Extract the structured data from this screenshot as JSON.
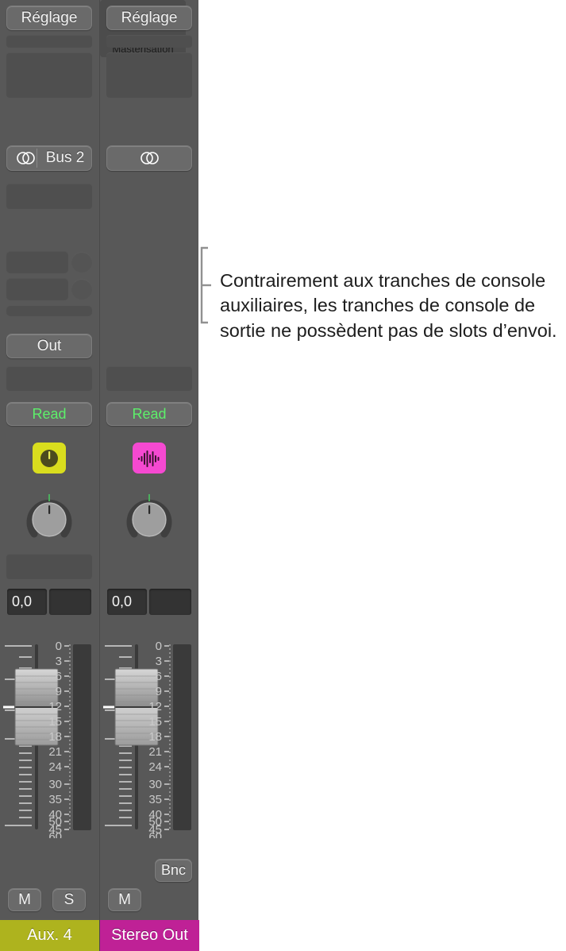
{
  "mixer": {
    "background_color": "#585858",
    "strips": [
      {
        "id": "aux4",
        "type": "auxiliary",
        "setting_button": "Réglage",
        "output_button": {
          "label": "Bus 2",
          "icon": "stereo-circles-icon"
        },
        "insert_label": "",
        "has_sends": true,
        "sends": [
          {
            "label": "",
            "knob": "send-level-knob"
          },
          {
            "label": "",
            "knob": "send-level-knob"
          }
        ],
        "group_button": "Out",
        "automation_button": "Read",
        "automation_color": "#5df06a",
        "plugin_icon": {
          "name": "gain-knob-icon",
          "color": "#d9dd1e"
        },
        "pan_value": "",
        "volume_value": "0,0",
        "peak_value": "",
        "bounce_button": null,
        "mute_button": "M",
        "solo_button": "S",
        "name": "Aux. 4",
        "name_color": "#aeb31e",
        "scale_labels": [
          "0",
          "3",
          "6",
          "9",
          "12",
          "15",
          "18",
          "21",
          "24",
          "30",
          "35",
          "40",
          "45",
          "50",
          "60"
        ]
      },
      {
        "id": "stereoout",
        "type": "output",
        "setting_button": "Réglage",
        "output_button": {
          "label": "",
          "icon": "stereo-circles-icon"
        },
        "insert_label": "Mastérisation",
        "has_sends": false,
        "sends": [],
        "group_button": null,
        "automation_button": "Read",
        "automation_color": "#5df06a",
        "plugin_icon": {
          "name": "waveform-icon",
          "color": "#f549d1"
        },
        "pan_value": "",
        "volume_value": "0,0",
        "peak_value": "",
        "bounce_button": "Bnc",
        "mute_button": "M",
        "solo_button": null,
        "name": "Stereo Out",
        "name_color": "#bf2196",
        "scale_labels": [
          "0",
          "3",
          "6",
          "9",
          "12",
          "15",
          "18",
          "21",
          "24",
          "30",
          "35",
          "40",
          "45",
          "50",
          "60"
        ]
      }
    ]
  },
  "callout": {
    "bracket_color": "#919191",
    "text": "Contrairement aux tranches de console auxiliaires, les tranches de console de sortie ne possèdent pas de slots d’envoi."
  }
}
